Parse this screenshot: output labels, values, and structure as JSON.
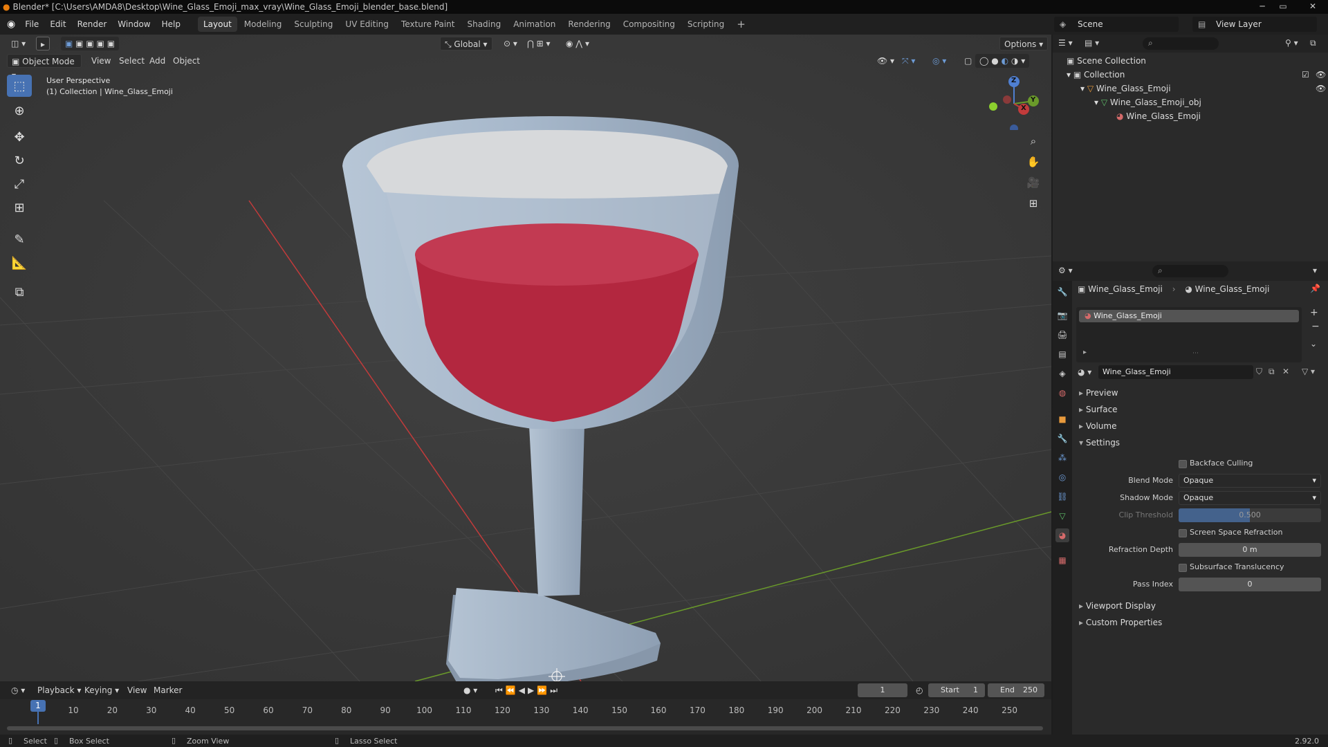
{
  "window": {
    "title": "Blender* [C:\\Users\\AMDA8\\Desktop\\Wine_Glass_Emoji_max_vray\\Wine_Glass_Emoji_blender_base.blend]"
  },
  "menu": {
    "items": [
      "File",
      "Edit",
      "Render",
      "Window",
      "Help"
    ]
  },
  "workspaces": [
    "Layout",
    "Modeling",
    "Sculpting",
    "UV Editing",
    "Texture Paint",
    "Shading",
    "Animation",
    "Rendering",
    "Compositing",
    "Scripting"
  ],
  "workspace_add": "+",
  "scene": {
    "name": "Scene",
    "view_layer": "View Layer"
  },
  "viewport": {
    "mode": "Object Mode",
    "menus": [
      "View",
      "Select",
      "Add",
      "Object"
    ],
    "orientation": "Global",
    "options": "Options",
    "info_line1": "User Perspective",
    "info_line2": "(1) Collection | Wine_Glass_Emoji",
    "gizmo": {
      "z": "Z",
      "y": "Y",
      "x": "X"
    }
  },
  "timeline": {
    "menus": [
      "Playback",
      "Keying",
      "View",
      "Marker"
    ],
    "current_frame": "1",
    "start_label": "Start",
    "start_value": "1",
    "end_label": "End",
    "end_value": "250",
    "frame_marker": "1",
    "ticks": [
      "10",
      "20",
      "30",
      "40",
      "50",
      "60",
      "70",
      "80",
      "90",
      "100",
      "110",
      "120",
      "130",
      "140",
      "150",
      "160",
      "170",
      "180",
      "190",
      "200",
      "210",
      "220",
      "230",
      "240",
      "250"
    ]
  },
  "statusbar": {
    "select": "Select",
    "box_select": "Box Select",
    "zoom_view": "Zoom View",
    "lasso_select": "Lasso Select",
    "version": "2.92.0"
  },
  "outliner": {
    "rows": [
      {
        "label": "Scene Collection"
      },
      {
        "label": "Collection"
      },
      {
        "label": "Wine_Glass_Emoji"
      },
      {
        "label": "Wine_Glass_Emoji_obj"
      },
      {
        "label": "Wine_Glass_Emoji"
      }
    ]
  },
  "properties": {
    "breadcrumb_object": "Wine_Glass_Emoji",
    "breadcrumb_material": "Wine_Glass_Emoji",
    "slot_name": "Wine_Glass_Emoji",
    "material_name": "Wine_Glass_Emoji",
    "panels": {
      "preview": "Preview",
      "surface": "Surface",
      "volume": "Volume",
      "settings": "Settings",
      "viewport_display": "Viewport Display",
      "custom_properties": "Custom Properties"
    },
    "settings": {
      "backface_culling": "Backface Culling",
      "blend_mode_label": "Blend Mode",
      "blend_mode": "Opaque",
      "shadow_mode_label": "Shadow Mode",
      "shadow_mode": "Opaque",
      "clip_threshold_label": "Clip Threshold",
      "clip_threshold": "0.500",
      "screen_space_refraction": "Screen Space Refraction",
      "refraction_depth_label": "Refraction Depth",
      "refraction_depth": "0 m",
      "subsurface_translucency": "Subsurface Translucency",
      "pass_index_label": "Pass Index",
      "pass_index": "0"
    }
  },
  "colors": {
    "accent": "#4772b3",
    "wine": "#b3273f",
    "glass": "#9fb2c6",
    "axis_x": "#c23b3b",
    "axis_y": "#6a9a2a"
  }
}
